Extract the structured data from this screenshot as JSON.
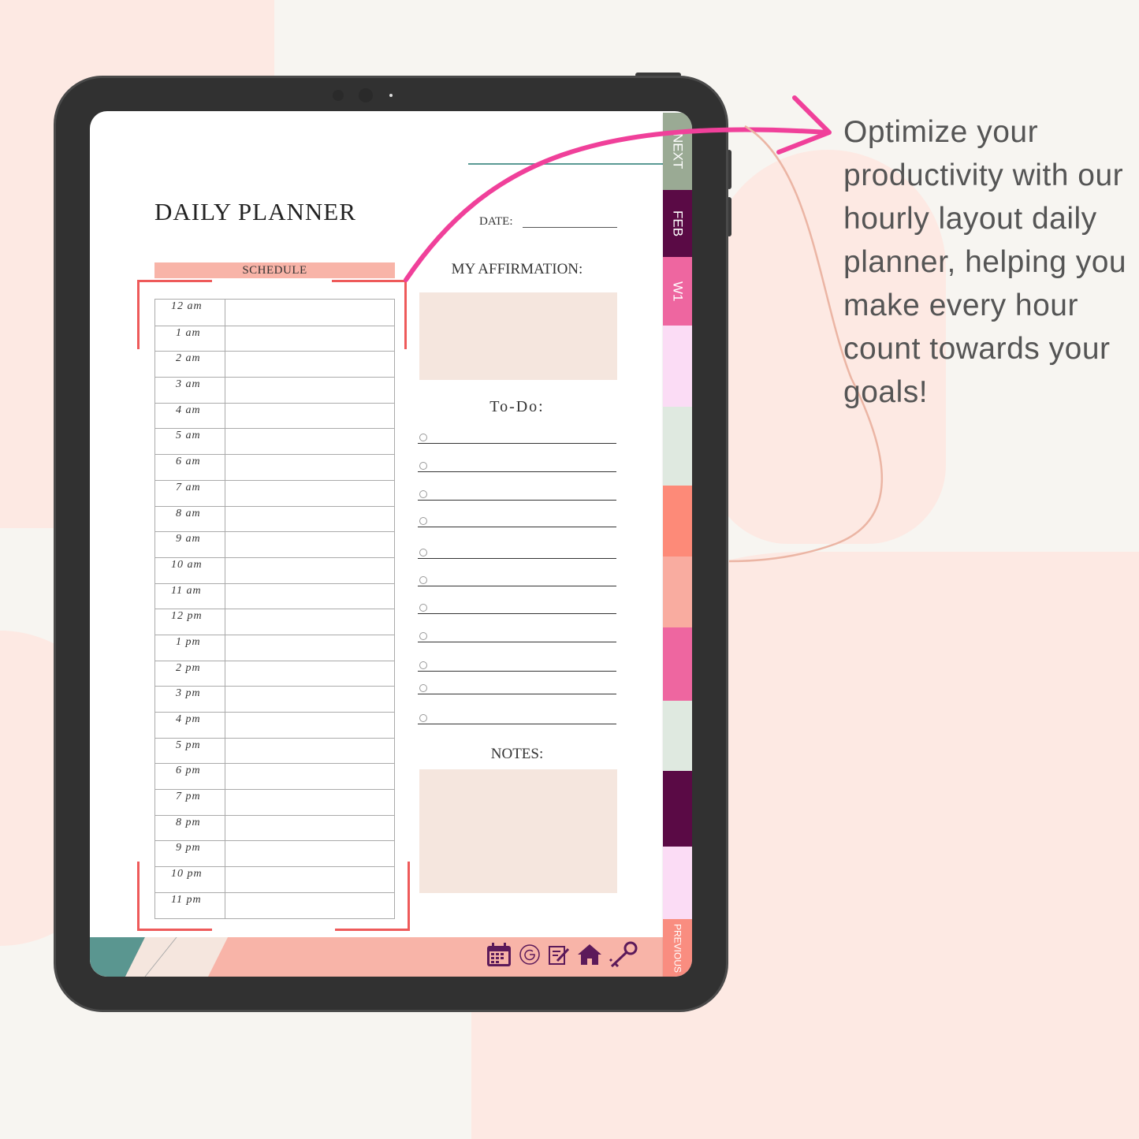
{
  "planner": {
    "title": "DAILY PLANNER",
    "schedule_label": "SCHEDULE",
    "hours": [
      "12  am",
      "1  am",
      "2  am",
      "3  am",
      "4  am",
      "5  am",
      "6  am",
      "7  am",
      "8  am",
      "9  am",
      "10  am",
      "11  am",
      "12  pm",
      "1  pm",
      "2  pm",
      "3  pm",
      "4  pm",
      "5  pm",
      "6  pm",
      "7  pm",
      "8  pm",
      "9  pm",
      "10  pm",
      "11  pm"
    ],
    "date_label": "DATE:",
    "affirmation_label": "MY AFFIRMATION:",
    "todo_label": "To-Do:",
    "todo_count": 11,
    "notes_label": "NOTES:"
  },
  "tabs": [
    {
      "label": "NEXT",
      "color": "#9aaa94"
    },
    {
      "label": "FEB",
      "color": "#5a0a45"
    },
    {
      "label": "W1",
      "color": "#ee66a0"
    },
    {
      "label": "",
      "color": "#fbdcf5"
    },
    {
      "label": "",
      "color": "#dfe9e0"
    },
    {
      "label": "",
      "color": "#fd8a78"
    },
    {
      "label": "",
      "color": "#f9aca0"
    },
    {
      "label": "",
      "color": "#ee66a0"
    },
    {
      "label": "",
      "color": "#dfe9e0"
    },
    {
      "label": "",
      "color": "#5a0a45"
    },
    {
      "label": "",
      "color": "#fbdcf5"
    },
    {
      "label": "PREVIOUS",
      "color": "#f98d80"
    }
  ],
  "footer_icons": [
    "calendar-icon",
    "google-icon",
    "notes-edit-icon",
    "home-icon",
    "key-icon"
  ],
  "headline": "Optimize your productivity with our hourly layout daily planner, helping you make every hour count towards your goals!",
  "colors": {
    "accent_arrow": "#f0409a",
    "bracket": "#ee5a5a",
    "icon": "#5c1a5a"
  }
}
